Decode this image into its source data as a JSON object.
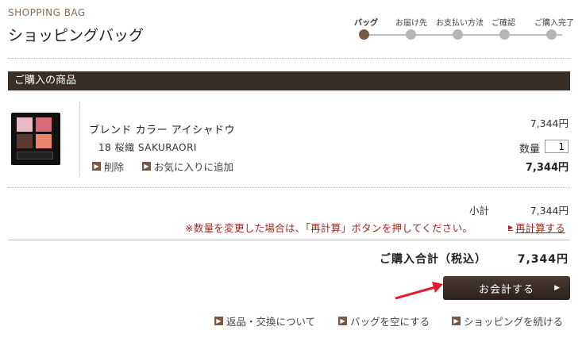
{
  "header": {
    "title_en": "SHOPPING BAG",
    "title_ja": "ショッピングバッグ"
  },
  "steps": [
    {
      "label": "バッグ",
      "active": true
    },
    {
      "label": "お届け先",
      "active": false
    },
    {
      "label": "お支払い方法",
      "active": false
    },
    {
      "label": "ご確認",
      "active": false
    },
    {
      "label": "ご購入完了",
      "active": false
    }
  ],
  "section_title": "ご購入の商品",
  "product": {
    "name": "ブレンド カラー アイシャドウ",
    "variant": "18 桜織 SAKURAORI",
    "unit_price": "7,344円",
    "qty_label": "数量",
    "qty_value": "1",
    "line_total": "7,344円",
    "delete_label": "削除",
    "favorite_label": "お気に入りに追加"
  },
  "summary": {
    "subtotal_label": "小計",
    "subtotal_value": "7,344円",
    "notice": "※数量を変更した場合は、「再計算」ボタンを押してください。",
    "recalc_label": "再計算する",
    "total_label": "ご購入合計（税込）",
    "total_value": "7,344円"
  },
  "checkout_label": "お会計する",
  "footer_links": {
    "returns": "返品・交換について",
    "empty_bag": "バッグを空にする",
    "continue_shopping": "ショッピングを続ける"
  },
  "colors": {
    "accent": "#7a5845",
    "dark": "#3b2e28",
    "notice": "#a0281e",
    "annotation_arrow": "#e8192c"
  }
}
